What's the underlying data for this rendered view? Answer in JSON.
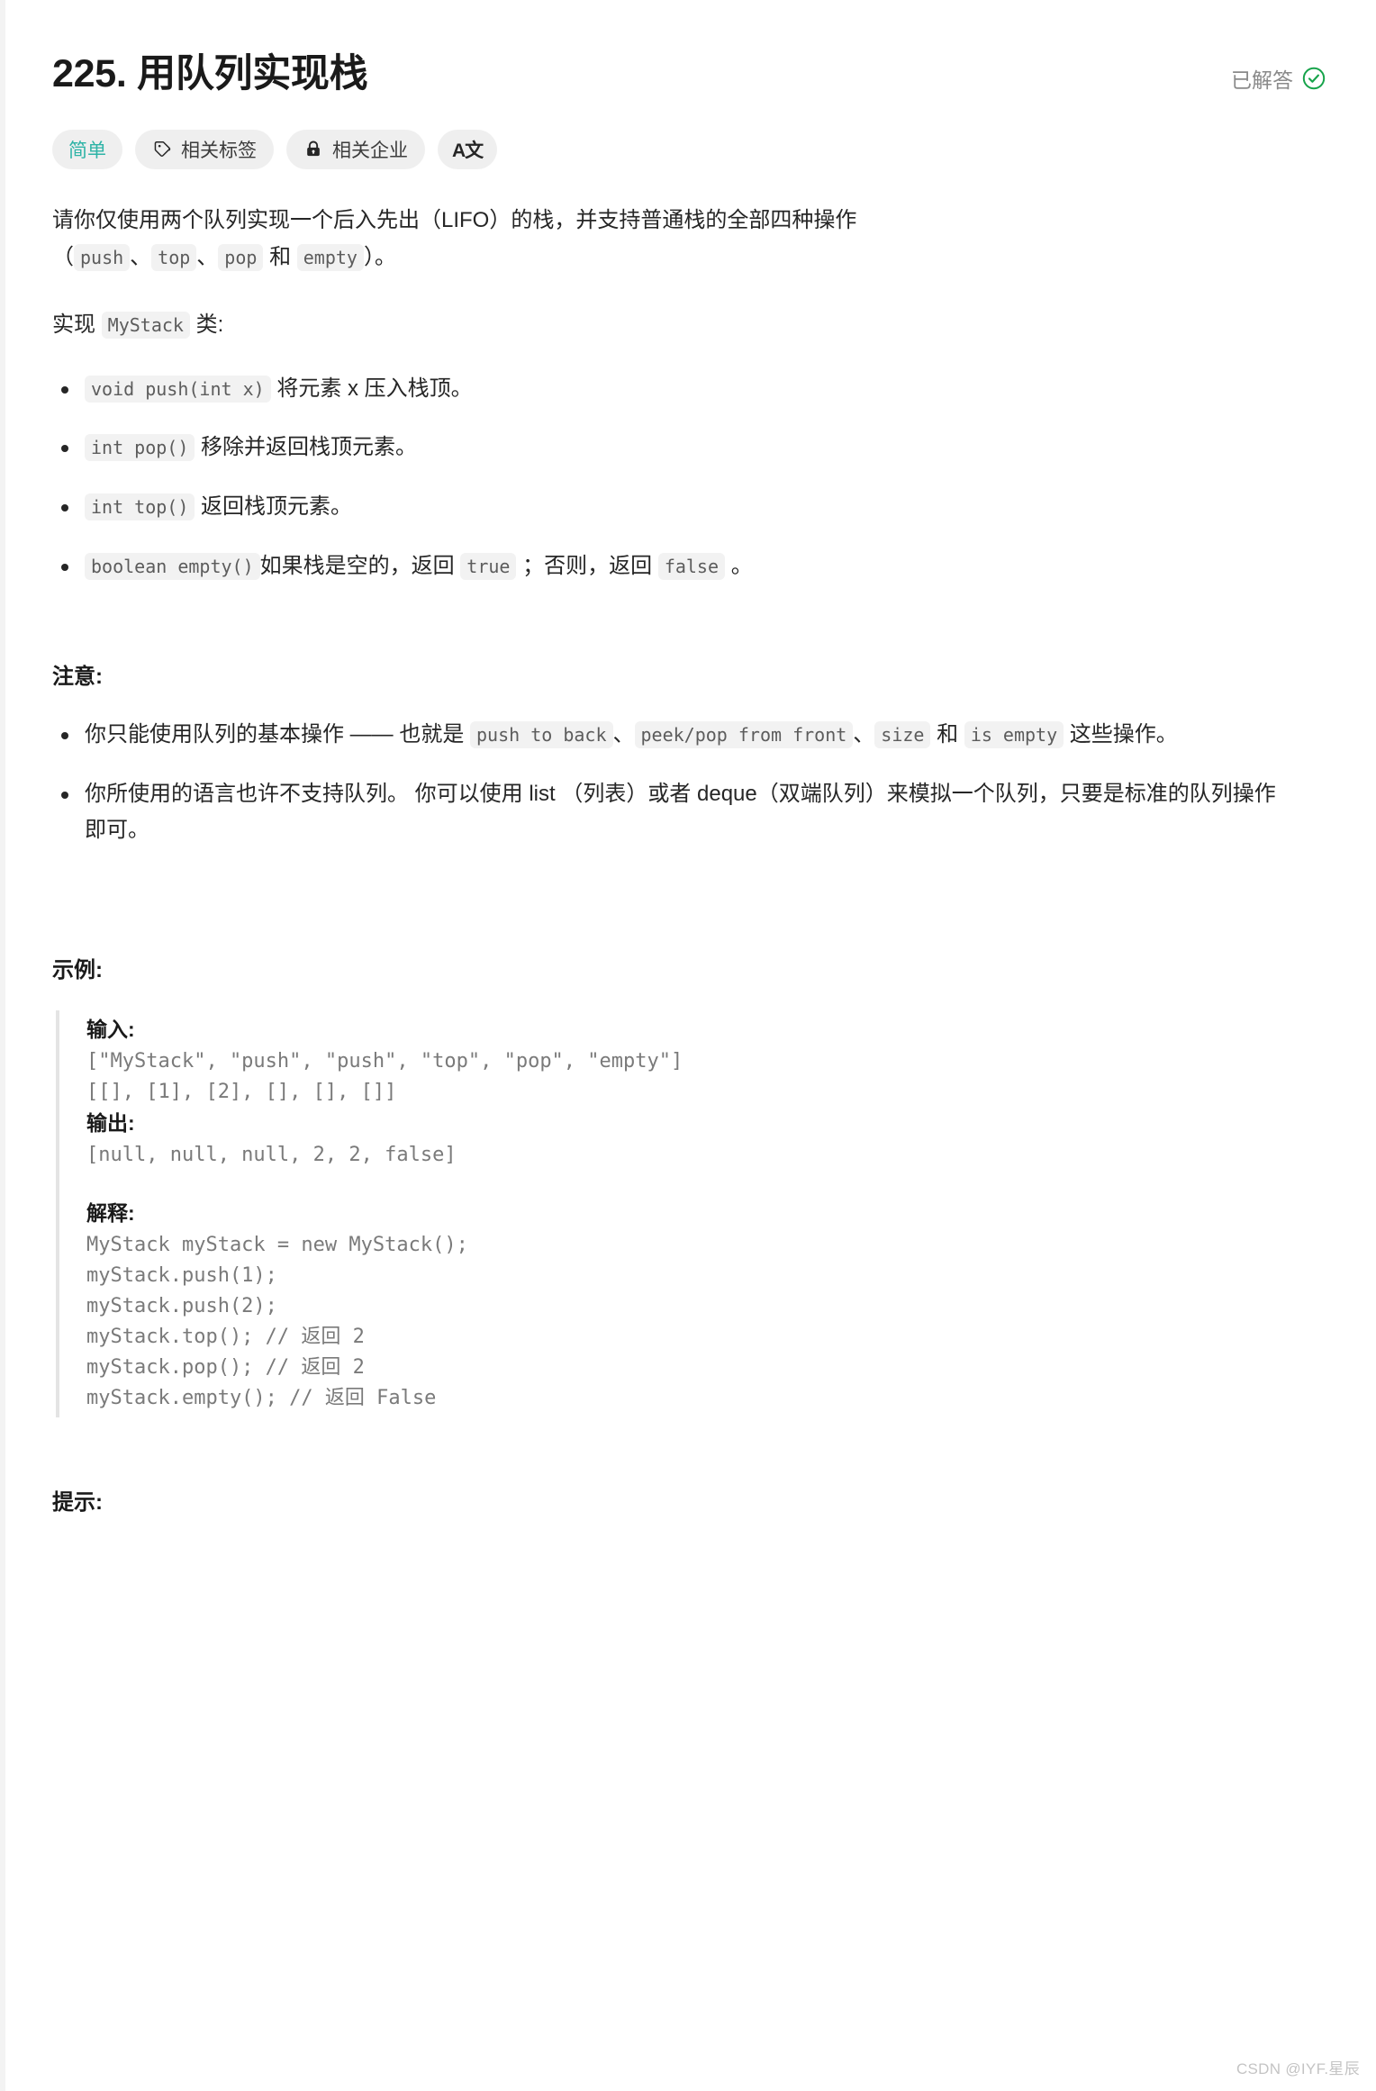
{
  "header": {
    "title": "225. 用队列实现栈",
    "status_label": "已解答",
    "status_color": "#16a34a"
  },
  "badges": [
    {
      "label": "简单",
      "icon": "none",
      "color": "#2db3a6",
      "name": "difficulty-badge"
    },
    {
      "label": "相关标签",
      "icon": "tag-icon",
      "color": "#3c3c3c",
      "name": "related-tags-button"
    },
    {
      "label": "相关企业",
      "icon": "lock-icon",
      "color": "#3c3c3c",
      "name": "related-companies-button"
    },
    {
      "label": "A文",
      "icon": "translate-icon",
      "color": "#262626",
      "name": "language-toggle-button"
    }
  ],
  "description": {
    "intro_1": "请你仅使用两个队列实现一个后入先出（LIFO）的栈，并支持普通栈的全部四种操作",
    "intro_2_open": "（",
    "intro_code_1": "push",
    "sep_1": "、",
    "intro_code_2": "top",
    "sep_2": "、",
    "intro_code_3": "pop",
    "sep_3": " 和 ",
    "intro_code_4": "empty",
    "intro_2_close": "）。",
    "implement_prefix": "实现 ",
    "implement_code": "MyStack",
    "implement_suffix": " 类:"
  },
  "methods": [
    {
      "code": "void push(int x)",
      "text": "将元素 x 压入栈顶。"
    },
    {
      "code": "int pop()",
      "text": "移除并返回栈顶元素。"
    },
    {
      "code": "int top()",
      "text": "返回栈顶元素。"
    },
    {
      "code": "boolean empty()",
      "text_before": "如果栈是空的，返回 ",
      "code_true": "true",
      "text_mid": " ；否则，返回 ",
      "code_false": "false",
      "text_after": " 。"
    }
  ],
  "note": {
    "title": "注意:",
    "item1": {
      "part1": "你只能使用队列的基本操作 —— 也就是 ",
      "code1": "push to back",
      "sep1": "、",
      "code2": "peek/pop from front",
      "sep2": "、",
      "code3": "size",
      "sep3": " 和 ",
      "code4": "is empty",
      "part2": " 这些操作。"
    },
    "item2": "你所使用的语言也许不支持队列。 你可以使用 list （列表）或者 deque（双端队列）来模拟一个队列，只要是标准的队列操作即可。"
  },
  "example": {
    "title": "示例:",
    "input_label": "输入:",
    "input_line_1": "[\"MyStack\", \"push\", \"push\", \"top\", \"pop\", \"empty\"]",
    "input_line_2": "[[], [1], [2], [], [], []]",
    "output_label": "输出:",
    "output_line": "[null, null, null, 2, 2, false]",
    "explain_label": "解释:",
    "explain_code": "MyStack myStack = new MyStack();\nmyStack.push(1);\nmyStack.push(2);\nmyStack.top(); // 返回 2\nmyStack.pop(); // 返回 2\nmyStack.empty(); // 返回 False"
  },
  "hints": {
    "title": "提示:"
  },
  "watermark": {
    "text": "CSDN @IYF.星辰"
  }
}
